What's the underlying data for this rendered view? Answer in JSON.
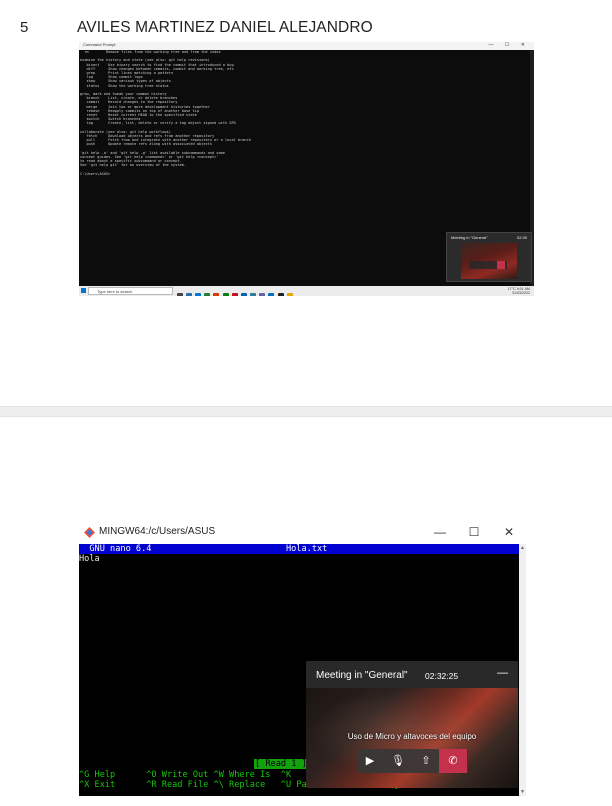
{
  "header": {
    "page_number": "5",
    "student_name": "AVILES MARTINEZ DANIEL ALEJANDRO"
  },
  "screenshot1": {
    "window_title": "Command Prompt",
    "terminal_lines": [
      "  rm        Remove files from the working tree and from the index",
      "",
      "examine the history and state (see also: git help revisions)",
      "   bisect    Use binary search to find the commit that introduced a bug",
      "   diff      Show changes between commits, commit and working tree, etc",
      "   grep      Print lines matching a pattern",
      "   log       Show commit logs",
      "   show      Show various types of objects",
      "   status    Show the working tree status",
      "",
      "grow, mark and tweak your common history",
      "   branch    List, create, or delete branches",
      "   commit    Record changes to the repository",
      "   merge     Join two or more development histories together",
      "   rebase    Reapply commits on top of another base tip",
      "   reset     Reset current HEAD to the specified state",
      "   switch    Switch branches",
      "   tag       Create, list, delete or verify a tag object signed with GPG",
      "",
      "collaborate (see also: git help workflows)",
      "   fetch     Download objects and refs from another repository",
      "   pull      Fetch from and integrate with another repository or a local branch",
      "   push      Update remote refs along with associated objects",
      "",
      "'git help -a' and 'git help -g' list available subcommands and some",
      "concept guides. See 'git help <command>' or 'git help <concept>'",
      "to read about a specific subcommand or concept.",
      "See 'git help git' for an overview of the system.",
      "",
      "C:\\Users\\ASUS>"
    ],
    "meeting_label": "Meeting in \"General\"",
    "meeting_time": "02:30",
    "taskbar_search": "Type here to search",
    "tray_text": "17°C",
    "tray_time": "9:01 AM",
    "tray_date": "31/03/2022",
    "taskbar_icon_colors": [
      "#444444",
      "#2b6cb0",
      "#0078d4",
      "#1e7e34",
      "#d83b01",
      "#107c10",
      "#c50f1f",
      "#0063b1",
      "#2d7d9a",
      "#6264a7",
      "#0f6cbd",
      "#222222",
      "#e3a600"
    ]
  },
  "screenshot2": {
    "window_title": "MINGW64:/c/Users/ASUS",
    "minimize": "—",
    "maximize": "☐",
    "close": "✕",
    "nano_header": "  GNU nano 6.4                          Hola.txt",
    "file_content": "Hola",
    "status_message": "[ Read 1 ]",
    "help_line1": "^G Help      ^O Write Out ^W Where Is  ^K",
    "help_line2": "^X Exit      ^R Read File ^\\ Replace   ^U Paste     ^J Justify  ^/ Go To Line",
    "meeting": {
      "title": "Meeting in \"General\"",
      "time": "02:32:25",
      "minimize": "—",
      "subtitle": "Uso de Micro y altavoces del equipo",
      "camera_icon": "▶",
      "mic_icon": "🎙",
      "share_icon": "⇧",
      "hangup_icon": "✆"
    }
  }
}
